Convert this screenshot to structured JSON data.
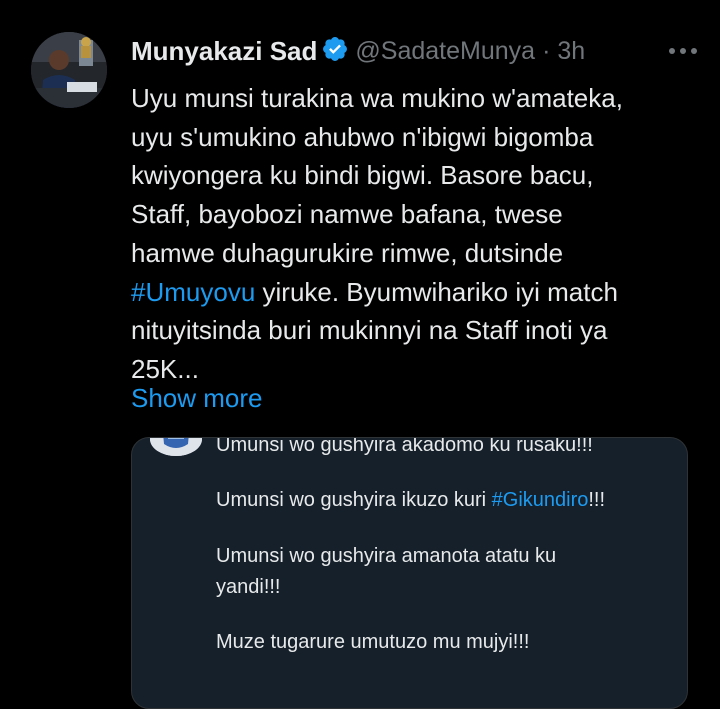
{
  "tweet": {
    "author_name": "Munyakazi Sad",
    "handle": "@SadateMunya",
    "separator": "·",
    "time": "3h",
    "text_lines": [
      {
        "before": "Uyu munsi turakina wa mukino w'amateka,",
        "hashtag": "",
        "after": ""
      },
      {
        "before": "uyu s'umukino ahubwo n'ibigwi bigomba",
        "hashtag": "",
        "after": ""
      },
      {
        "before": "kwiyongera ku bindi bigwi. Basore bacu,",
        "hashtag": "",
        "after": ""
      },
      {
        "before": "Staff, bayobozi namwe bafana, twese",
        "hashtag": "",
        "after": ""
      },
      {
        "before": "hamwe duhagurukire rimwe, dutsinde",
        "hashtag": "",
        "after": ""
      },
      {
        "before": "",
        "hashtag": "#Umuyovu",
        "after": " yiruke. Byumwihariko iyi match"
      },
      {
        "before": "nituyitsinda buri mukinnyi na Staff inoti ya",
        "hashtag": "",
        "after": ""
      },
      {
        "before": "25K...",
        "hashtag": "",
        "after": ""
      }
    ],
    "show_more": "Show more"
  },
  "quote": {
    "line1": "Umunsi wo gushyira akadomo ku rusaku!!!",
    "line2_before": "Umunsi wo gushyira ikuzo kuri ",
    "line2_hashtag": "#Gikundiro",
    "line2_after": "!!!",
    "line3": "Umunsi wo gushyira amanota atatu ku",
    "line4": "yandi!!!",
    "line5": "Muze tugarure umutuzo mu mujyi!!!"
  },
  "colors": {
    "background": "#000000",
    "text": "#e7e9ea",
    "muted": "#71767b",
    "accent": "#1d9bf0",
    "quote_background": "#15202b",
    "border": "#2f3336"
  },
  "icons": {
    "verified": "verified-badge-icon",
    "more": "more-horizontal-icon"
  }
}
